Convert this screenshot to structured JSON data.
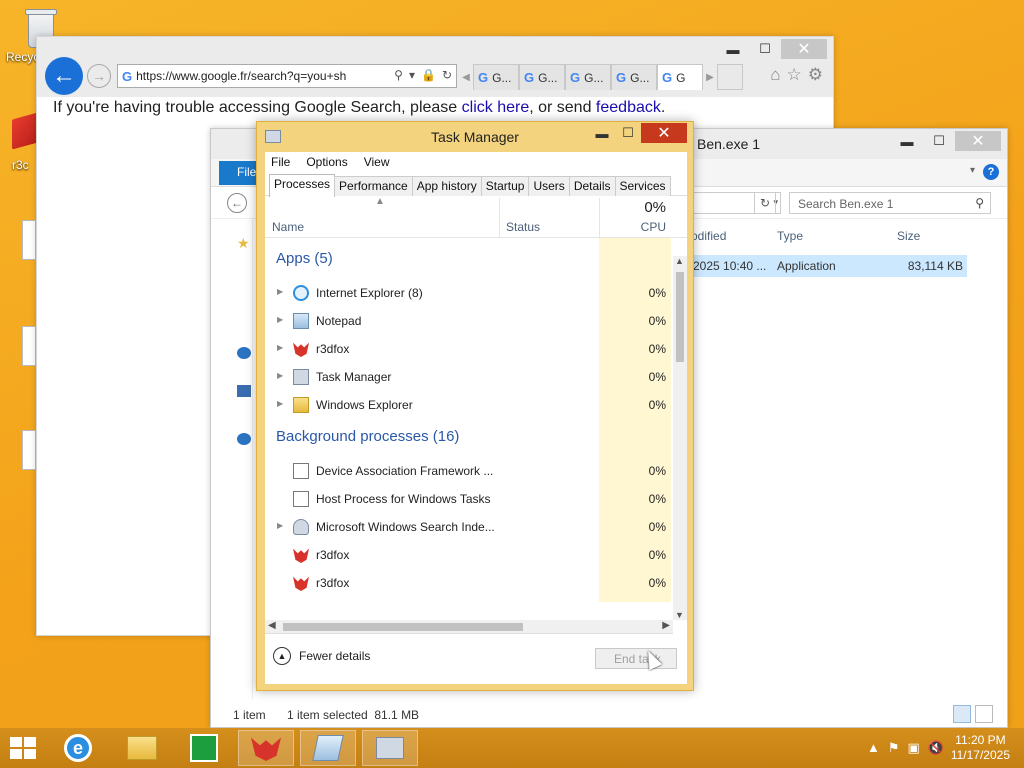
{
  "desktop": {
    "recycle_bin_label": "Recyc",
    "r3_label": "r3c"
  },
  "ie": {
    "address_value": "https://www.google.fr/search?q=you+sh",
    "tabs": [
      "G...",
      "G...",
      "G...",
      "G...",
      "G"
    ],
    "message_prefix": "If you're having trouble accessing Google Search, please ",
    "link_click_here": "click here",
    "message_middle": ", or send ",
    "link_feedback": "feedback",
    "message_suffix": "."
  },
  "explorer": {
    "title": "Ben.exe 1",
    "file_tab": "File",
    "search_placeholder": "Search Ben.exe 1",
    "col_modified": "odified",
    "col_type": "Type",
    "col_size": "Size",
    "row_modified": "2025 10:40 ...",
    "row_type": "Application",
    "row_size": "83,114 KB",
    "status_items": "1 item",
    "status_selected": "1 item selected  81.1 MB"
  },
  "task_manager": {
    "title": "Task Manager",
    "menu": [
      "File",
      "Options",
      "View"
    ],
    "tabs": [
      "Processes",
      "Performance",
      "App history",
      "Startup",
      "Users",
      "Details",
      "Services"
    ],
    "col_name": "Name",
    "col_status": "Status",
    "cpu_total": "0%",
    "col_cpu": "CPU",
    "apps_group": "Apps (5)",
    "apps": [
      {
        "name": "Internet Explorer (8)",
        "cpu": "0%",
        "icon": "ie-icon"
      },
      {
        "name": "Notepad",
        "cpu": "0%",
        "icon": "notepad-icon"
      },
      {
        "name": "r3dfox",
        "cpu": "0%",
        "icon": "r3dfox-icon"
      },
      {
        "name": "Task Manager",
        "cpu": "0%",
        "icon": "task-manager-icon"
      },
      {
        "name": "Windows Explorer",
        "cpu": "0%",
        "icon": "folder-icon"
      }
    ],
    "bg_group": "Background processes (16)",
    "background": [
      {
        "name": "Device Association Framework ...",
        "cpu": "0%",
        "icon": "system-process-icon"
      },
      {
        "name": "Host Process for Windows Tasks",
        "cpu": "0%",
        "icon": "system-process-icon"
      },
      {
        "name": "Microsoft Windows Search Inde...",
        "cpu": "0%",
        "icon": "search-indexer-icon"
      },
      {
        "name": "r3dfox",
        "cpu": "0%",
        "icon": "r3dfox-icon"
      },
      {
        "name": "r3dfox",
        "cpu": "0%",
        "icon": "r3dfox-icon"
      }
    ],
    "fewer_details": "Fewer details",
    "end_task": "End task"
  },
  "taskbar": {
    "time": "11:20 PM",
    "date": "11/17/2025"
  },
  "colors": {
    "desktop_bg": "#f5a623",
    "tm_frame": "#f3d37d",
    "accent_blue": "#1a70d6",
    "group_blue": "#2a58a8",
    "close_red": "#c7391c"
  }
}
